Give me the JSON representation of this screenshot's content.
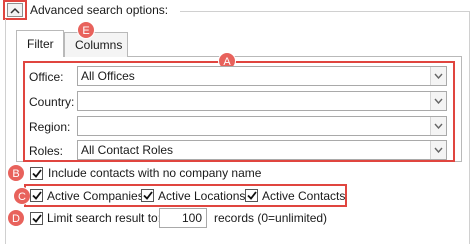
{
  "header": {
    "advanced_label": "Advanced search options:"
  },
  "tabs": [
    {
      "label": "Filter"
    },
    {
      "label": "Columns"
    }
  ],
  "filter": {
    "office": {
      "label": "Office:",
      "value": "All Offices"
    },
    "country": {
      "label": "Country:",
      "value": ""
    },
    "region": {
      "label": "Region:",
      "value": ""
    },
    "roles": {
      "label": "Roles:",
      "value": "All Contact Roles"
    }
  },
  "options": {
    "include_no_company": {
      "label": "Include contacts with no company name",
      "checked": true
    },
    "active_companies": {
      "label": "Active Companies",
      "checked": true
    },
    "active_locations": {
      "label": "Active Locations",
      "checked": true
    },
    "active_contacts": {
      "label": "Active Contacts",
      "checked": true
    },
    "limit_results": {
      "label": "Limit search result to:",
      "checked": true,
      "value": "100",
      "suffix": "records (0=unlimited)"
    }
  },
  "markers": {
    "a": "A",
    "b": "B",
    "c": "C",
    "d": "D",
    "e": "E"
  },
  "colors": {
    "highlight": "#e0453f",
    "marker": "#e8625c"
  }
}
